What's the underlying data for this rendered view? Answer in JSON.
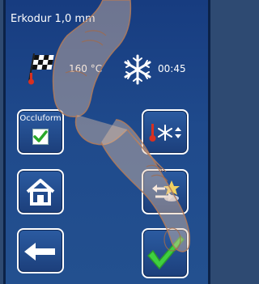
{
  "header": {
    "title": "Erkodur 1,0 mm"
  },
  "status": {
    "temperature": "160 °C",
    "temperature_icon": "finish-flag-icon",
    "cooling_time": "00:45",
    "cooling_icon": "snowflake-icon"
  },
  "buttons": {
    "occluform": {
      "label": "Occluform",
      "checked": true
    },
    "home": {
      "icon": "home-icon"
    },
    "back": {
      "icon": "arrow-left-icon"
    },
    "settings": {
      "icon": "temperature-cooling-adjust-icon"
    },
    "swap": {
      "icon": "swap-material-icon"
    },
    "confirm": {
      "icon": "checkmark-icon"
    }
  },
  "colors": {
    "background": "#1f4a8c",
    "accent": "#3fcf3f",
    "thermo": "#d83020"
  }
}
